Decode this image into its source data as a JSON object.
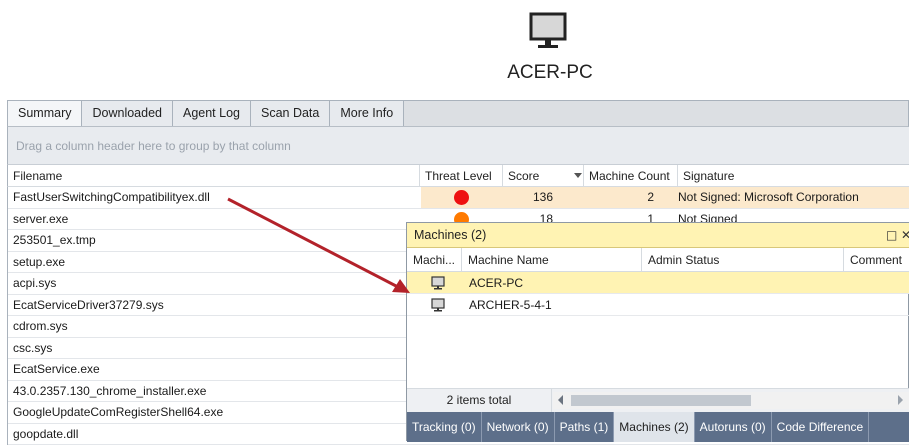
{
  "header": {
    "machine_name": "ACER-PC",
    "icon": "monitor-icon"
  },
  "tabs": [
    {
      "label": "Summary"
    },
    {
      "label": "Downloaded"
    },
    {
      "label": "Agent Log"
    },
    {
      "label": "Scan Data"
    },
    {
      "label": "More Info"
    }
  ],
  "group_panel": {
    "hint": "Drag a column header here to group by that column"
  },
  "columns": {
    "filename": "Filename",
    "threat_level": "Threat Level",
    "score": "Score",
    "machine_count": "Machine Count",
    "signature": "Signature"
  },
  "rows": [
    {
      "filename": "FastUserSwitchingCompatibilityex.dll",
      "threat_color": "#ee1111",
      "score": "136",
      "machine_count": "2",
      "signature": "Not Signed: Microsoft Corporation"
    },
    {
      "filename": "server.exe",
      "threat_color": "#ff7a00",
      "score": "18",
      "machine_count": "1",
      "signature": "Not Signed"
    },
    {
      "filename": "253501_ex.tmp"
    },
    {
      "filename": "setup.exe"
    },
    {
      "filename": "acpi.sys"
    },
    {
      "filename": "EcatServiceDriver37279.sys"
    },
    {
      "filename": "cdrom.sys"
    },
    {
      "filename": "csc.sys"
    },
    {
      "filename": "EcatService.exe"
    },
    {
      "filename": "43.0.2357.130_chrome_installer.exe"
    },
    {
      "filename": "GoogleUpdateComRegisterShell64.exe"
    },
    {
      "filename": "goopdate.dll"
    }
  ],
  "popup": {
    "title": "Machines (2)",
    "columns": {
      "icon": "Machi...",
      "machine_name": "Machine Name",
      "admin_status": "Admin Status",
      "comment": "Comment"
    },
    "rows": [
      {
        "machine_name": "ACER-PC"
      },
      {
        "machine_name": "ARCHER-5-4-1"
      }
    ],
    "items_total": "2 items total",
    "tabs": [
      {
        "label": "Tracking (0)"
      },
      {
        "label": "Network (0)"
      },
      {
        "label": "Paths (1)"
      },
      {
        "label": "Machines (2)"
      },
      {
        "label": "Autoruns (0)"
      },
      {
        "label": "Code Difference"
      }
    ]
  },
  "colors": {
    "highlight_row": "#fce9cc",
    "popup_title": "#fff3b3",
    "popup_tabbar": "#5d6f8a",
    "arrow": "#b3222a"
  }
}
